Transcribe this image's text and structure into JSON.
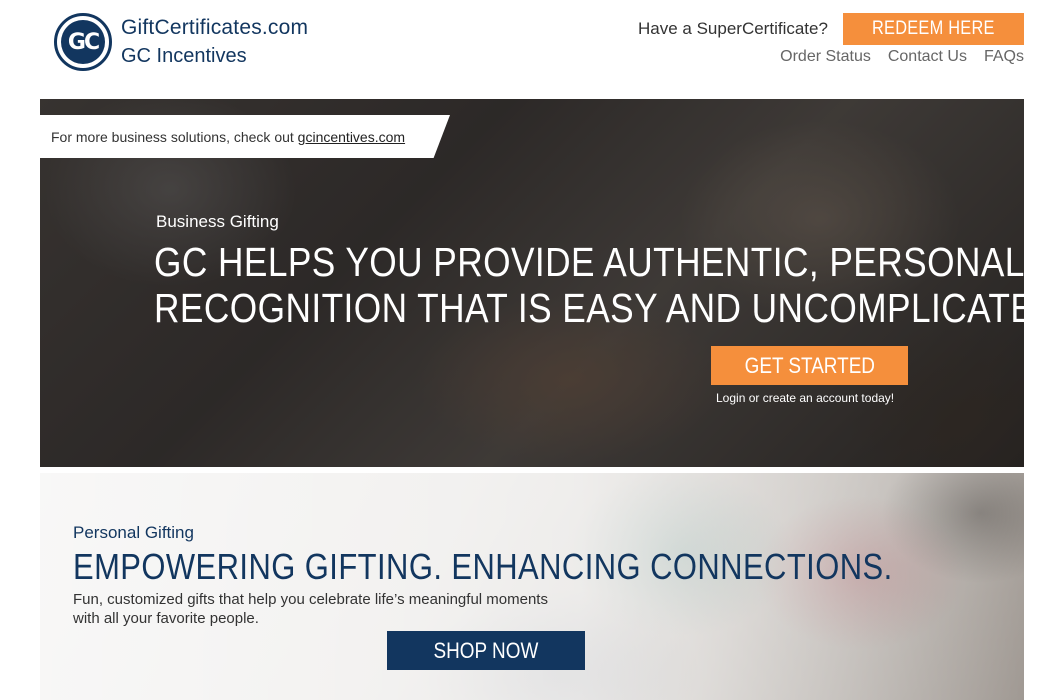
{
  "brand": {
    "logo_mark": "GC",
    "line1": "GiftCertificates.com",
    "line2": "GC Incentives",
    "primary_color": "#12365f"
  },
  "header": {
    "super_question": "Have a SuperCertificate?",
    "redeem_label": "REDEEM HERE",
    "accent_color": "#f58f3c",
    "nav": [
      "Order Status",
      "Contact Us",
      "FAQs"
    ]
  },
  "business": {
    "banner_text": "For more business solutions, check out",
    "banner_link": "gcincentives.com",
    "kicker": "Business Gifting",
    "headline_line1": "GC HELPS YOU PROVIDE AUTHENTIC, PERSONALIZED",
    "headline_line2": "RECOGNITION THAT IS EASY AND UNCOMPLICATED",
    "cta_label": "GET STARTED",
    "cta_note": "Login or create an account today!"
  },
  "personal": {
    "kicker": "Personal Gifting",
    "headline": "EMPOWERING GIFTING. ENHANCING CONNECTIONS.",
    "subtext": "Fun, customized gifts that help you celebrate life’s meaningful moments with all your favorite people.",
    "cta_label": "SHOP NOW"
  }
}
